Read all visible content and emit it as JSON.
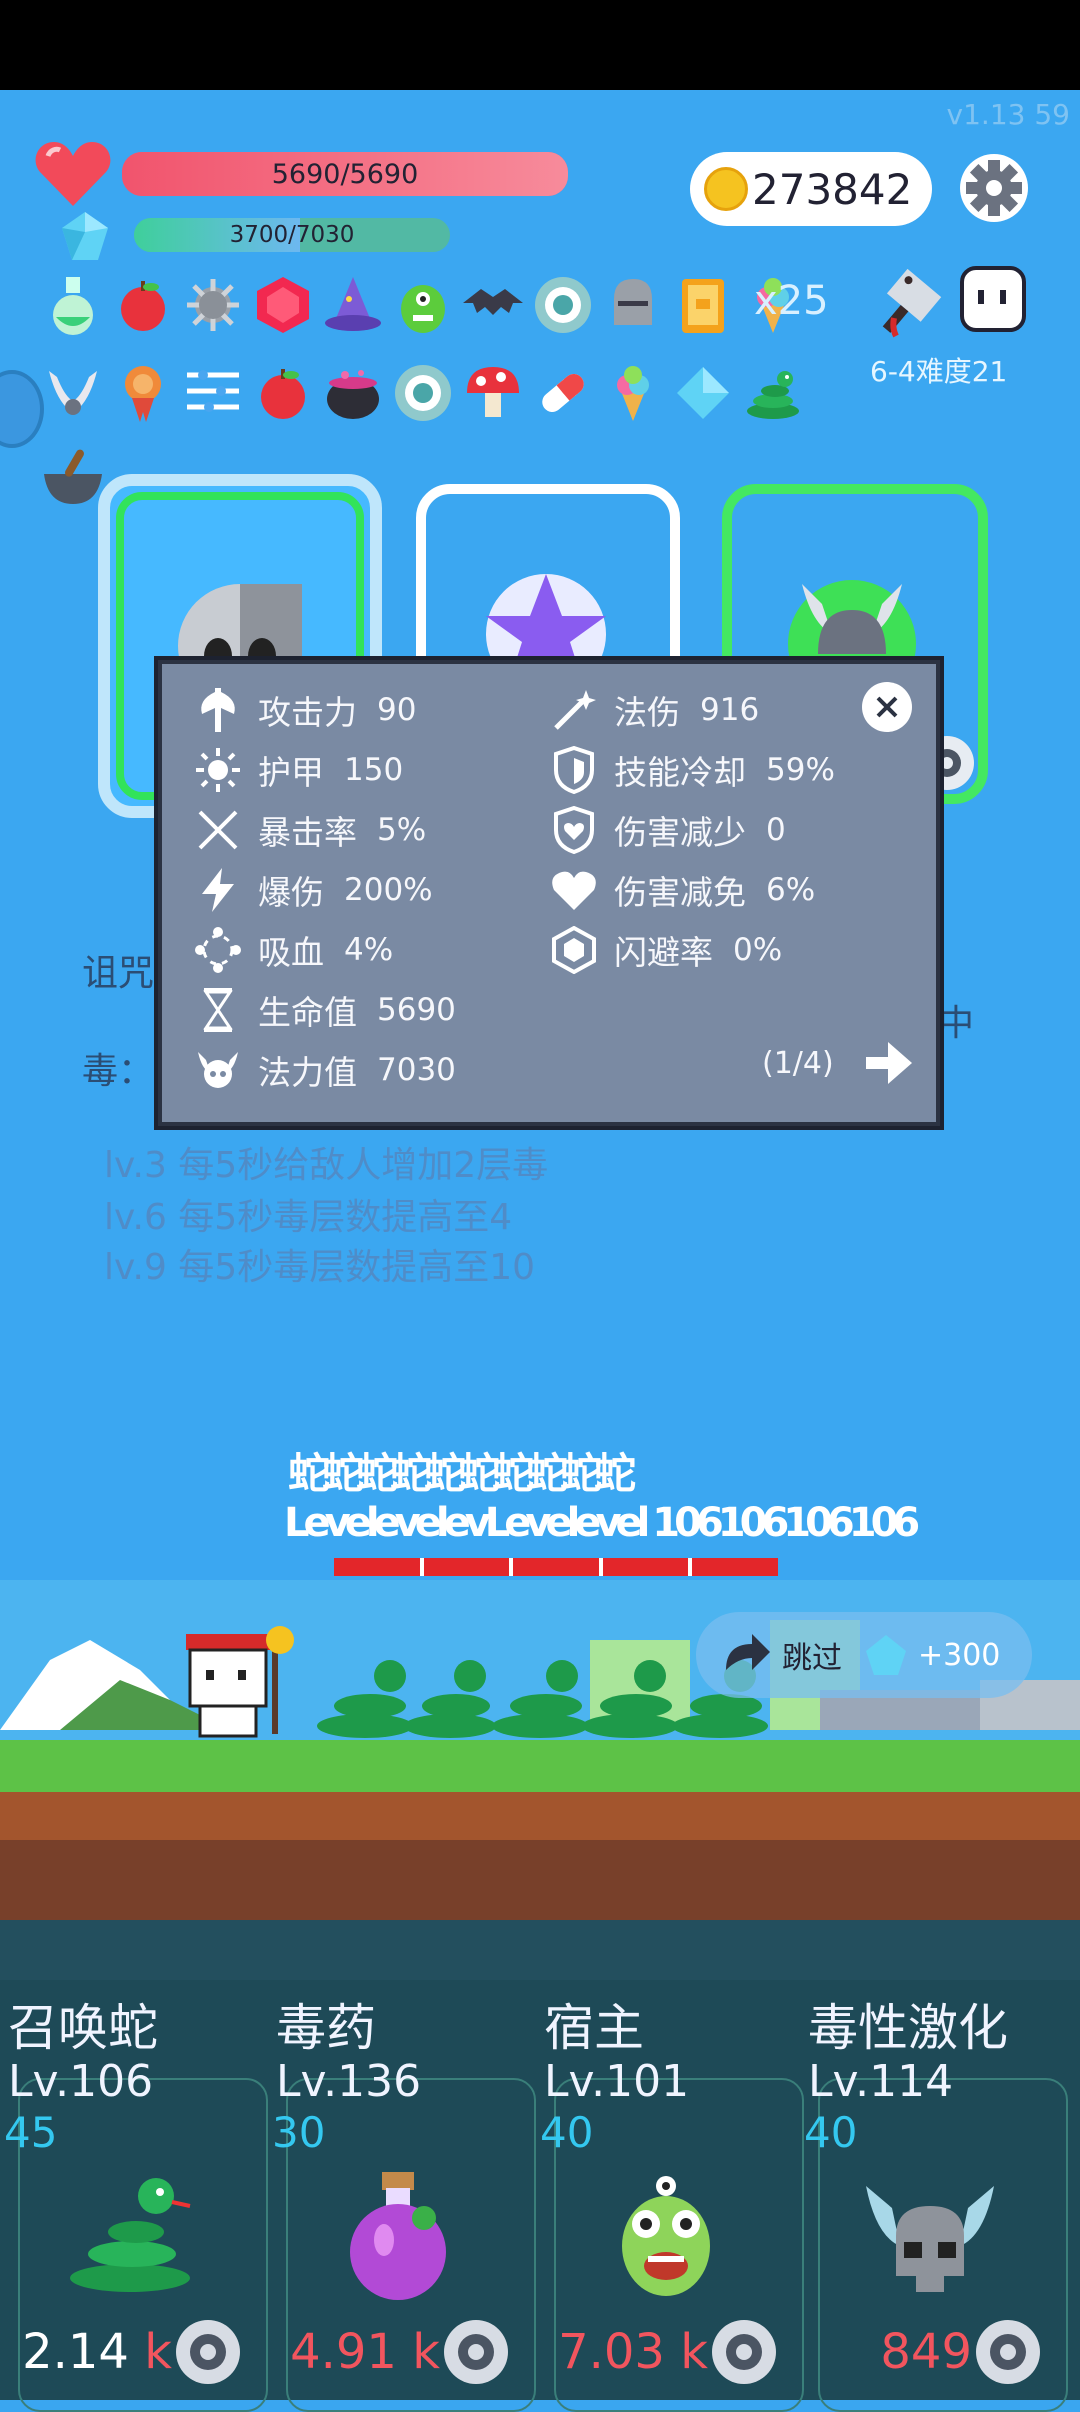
{
  "header": {
    "version": "v1.13   59",
    "hp_text": "5690/5690",
    "hp_fraction": 1.0,
    "mp_text": "3700/7030",
    "mp_fraction": 0.526,
    "coins": "273842",
    "item_multiplier": "x25",
    "stage_label": "6-4难度21"
  },
  "stats_popup": {
    "left": [
      {
        "label": "攻击力",
        "value": "90"
      },
      {
        "label": "护甲",
        "value": "150"
      },
      {
        "label": "暴击率",
        "value": "5%"
      },
      {
        "label": "爆伤",
        "value": "200%"
      },
      {
        "label": "吸血",
        "value": "4%"
      },
      {
        "label": "生命值",
        "value": "5690"
      },
      {
        "label": "法力值",
        "value": "7030"
      }
    ],
    "right": [
      {
        "label": "法伤",
        "value": "916"
      },
      {
        "label": "技能冷却",
        "value": "59%"
      },
      {
        "label": "伤害减少",
        "value": "0"
      },
      {
        "label": "伤害减免",
        "value": "6%"
      },
      {
        "label": "闪避率",
        "value": "0%"
      }
    ],
    "pager": "(1/4)"
  },
  "background_text": {
    "curse": "诅咒",
    "poison": "毒：",
    "right_fragment": "中",
    "desc": [
      "lv.3 每5秒给敌人增加2层毒",
      "lv.6 每5秒毒层数提高至4",
      "lv.9 每5秒毒层数提高至10"
    ]
  },
  "battle": {
    "enemy_name": "蛇蛇蛇蛇蛇蛇蛇蛇蛇蛇",
    "enemy_level": "LevelevelevLevelevel 106106106106",
    "skip_label": "跳过",
    "skip_reward": "+300"
  },
  "skills": [
    {
      "name": "召唤蛇",
      "level": "Lv.106",
      "cost": "45",
      "price_num": "2.14",
      "price_unit": "k",
      "icon": "snake-icon"
    },
    {
      "name": "毒药",
      "level": "Lv.136",
      "cost": "30",
      "price_num": "4.91",
      "price_unit": "k",
      "icon": "potion-icon"
    },
    {
      "name": "宿主",
      "level": "Lv.101",
      "cost": "40",
      "price_num": "7.03",
      "price_unit": "k",
      "icon": "monster-icon"
    },
    {
      "name": "毒性激化",
      "level": "Lv.114",
      "cost": "40",
      "price_num": "849",
      "price_unit": "",
      "icon": "horned-skull-icon"
    }
  ]
}
